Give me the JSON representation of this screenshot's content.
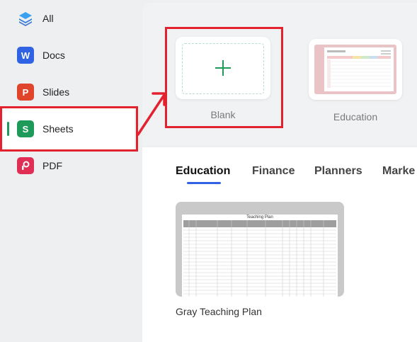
{
  "sidebar": {
    "items": [
      {
        "label": "All",
        "icon": "layers-icon"
      },
      {
        "label": "Docs",
        "icon": "docs-icon",
        "glyph": "W"
      },
      {
        "label": "Slides",
        "icon": "slides-icon",
        "glyph": "P"
      },
      {
        "label": "Sheets",
        "icon": "sheets-icon",
        "glyph": "S",
        "active": true
      },
      {
        "label": "PDF",
        "icon": "pdf-icon"
      }
    ]
  },
  "templates_top": {
    "blank_label": "Blank",
    "education_label": "Education"
  },
  "tabs": [
    {
      "label": "Education",
      "active": true
    },
    {
      "label": "Finance"
    },
    {
      "label": "Planners"
    },
    {
      "label": "Marke"
    }
  ],
  "template_cards": [
    {
      "name": "Gray Teaching Plan",
      "thumb_title": "Teaching Plan"
    }
  ],
  "colors": {
    "highlight_red": "#e2222e",
    "sheets_green": "#1e9a5a",
    "accent_blue": "#2f63e4"
  }
}
